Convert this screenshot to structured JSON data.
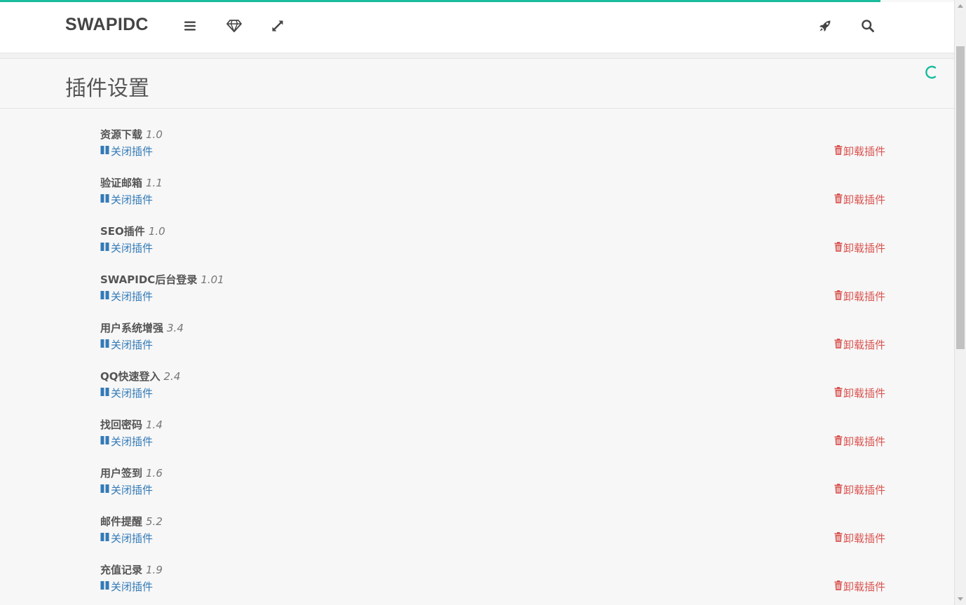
{
  "colors": {
    "accent": "#1abc9c",
    "link": "#337ab7",
    "danger": "#d9534f"
  },
  "navbar": {
    "brand": "SWAPIDC",
    "icons": {
      "menu": "bars-icon",
      "theme": "diamond-icon",
      "fullscreen": "expand-icon",
      "launch": "rocket-icon",
      "search": "search-icon"
    }
  },
  "header": {
    "title": "插件设置"
  },
  "plugins": [
    {
      "name": "资源下载",
      "version": "1.0",
      "toggle_label": "关闭插件",
      "uninstall_label": "卸载插件"
    },
    {
      "name": "验证邮箱",
      "version": "1.1",
      "toggle_label": "关闭插件",
      "uninstall_label": "卸载插件"
    },
    {
      "name": "SEO插件",
      "version": "1.0",
      "toggle_label": "关闭插件",
      "uninstall_label": "卸载插件"
    },
    {
      "name": "SWAPIDC后台登录",
      "version": "1.01",
      "toggle_label": "关闭插件",
      "uninstall_label": "卸载插件"
    },
    {
      "name": "用户系统增强",
      "version": "3.4",
      "toggle_label": "关闭插件",
      "uninstall_label": "卸载插件"
    },
    {
      "name": "QQ快速登入",
      "version": "2.4",
      "toggle_label": "关闭插件",
      "uninstall_label": "卸载插件"
    },
    {
      "name": "找回密码",
      "version": "1.4",
      "toggle_label": "关闭插件",
      "uninstall_label": "卸载插件"
    },
    {
      "name": "用户签到",
      "version": "1.6",
      "toggle_label": "关闭插件",
      "uninstall_label": "卸载插件"
    },
    {
      "name": "邮件提醒",
      "version": "5.2",
      "toggle_label": "关闭插件",
      "uninstall_label": "卸载插件"
    },
    {
      "name": "充值记录",
      "version": "1.9",
      "toggle_label": "关闭插件",
      "uninstall_label": "卸载插件"
    }
  ]
}
